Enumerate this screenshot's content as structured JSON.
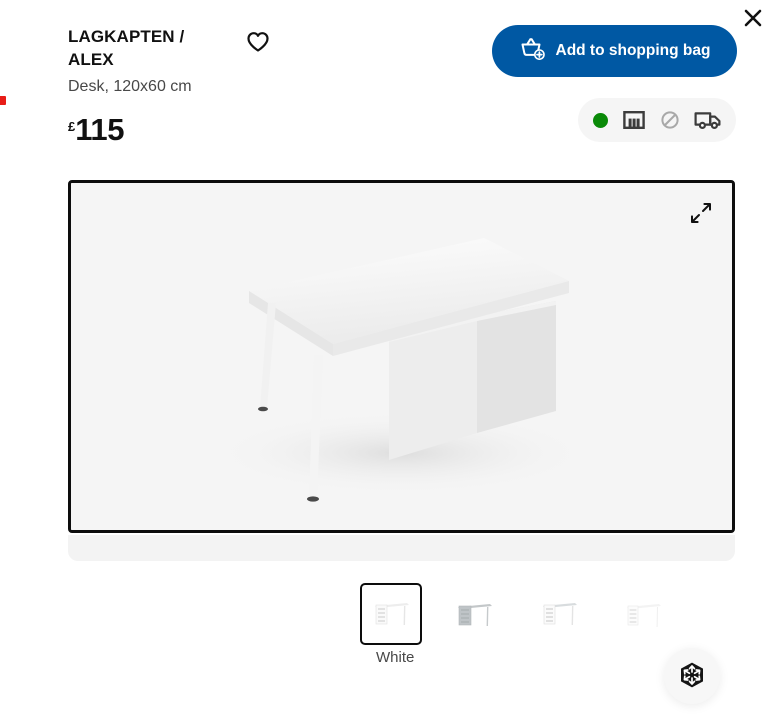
{
  "window": {
    "close_label": "×",
    "close_icon": "close-icon"
  },
  "product": {
    "name": "LAGKAPTEN / ALEX",
    "description": "Desk, 120x60 cm",
    "price": {
      "currency_symbol": "£",
      "amount": "115"
    },
    "favorite_icon": "heart-icon"
  },
  "actions": {
    "add_to_bag_label": "Add to shopping bag",
    "add_to_bag_icon": "shopping-basket-plus-icon",
    "button_color": "#0058a3"
  },
  "availability": {
    "stock_dot_icon": "green-status-dot",
    "stock_color": "#0a8a08",
    "store_icon": "store-building-icon",
    "unavailable_icon": "prohibited-icon",
    "delivery_icon": "delivery-truck-icon"
  },
  "gallery": {
    "expand_icon": "expand-arrows-icon",
    "main_image_alt": "White desk with cabinet, 120x60 cm",
    "ar_view_icon": "3d-cube-icon"
  },
  "variants": {
    "selected_label": "White",
    "items": [
      {
        "name": "white-desk-front",
        "selected": true
      },
      {
        "name": "grey-desk-angle",
        "selected": false
      },
      {
        "name": "white-desk-side",
        "selected": false
      },
      {
        "name": "white-desk-rear",
        "selected": false
      }
    ]
  }
}
